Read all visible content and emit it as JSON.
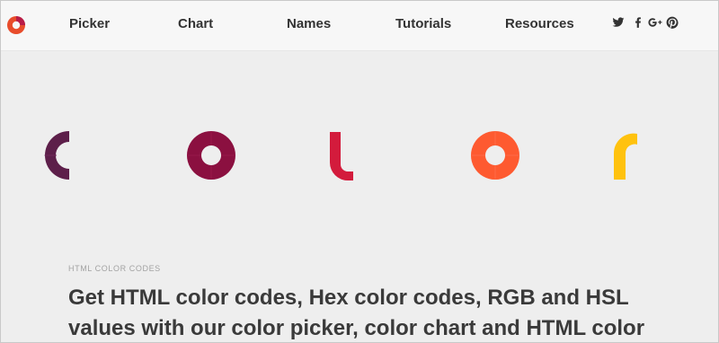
{
  "nav": {
    "items": [
      {
        "label": "Picker"
      },
      {
        "label": "Chart"
      },
      {
        "label": "Names"
      },
      {
        "label": "Tutorials"
      },
      {
        "label": "Resources"
      }
    ],
    "social": [
      "twitter-icon",
      "facebook-icon",
      "google-plus-icon",
      "pinterest-icon"
    ]
  },
  "hero": {
    "letters": [
      "c",
      "o",
      "l",
      "o",
      "r"
    ],
    "colors": {
      "c": "#5d1f4a",
      "o1": "#8b1040",
      "l": "#d31b3c",
      "o2": "#fe5a30",
      "r": "#ffc20e"
    }
  },
  "intro": {
    "eyebrow": "HTML COLOR CODES",
    "headline": "Get HTML color codes, Hex color codes, RGB and HSL values with our color picker, color chart and HTML color"
  },
  "brand": {
    "logo_colors": [
      "#e24a2d",
      "#8b1040"
    ]
  }
}
